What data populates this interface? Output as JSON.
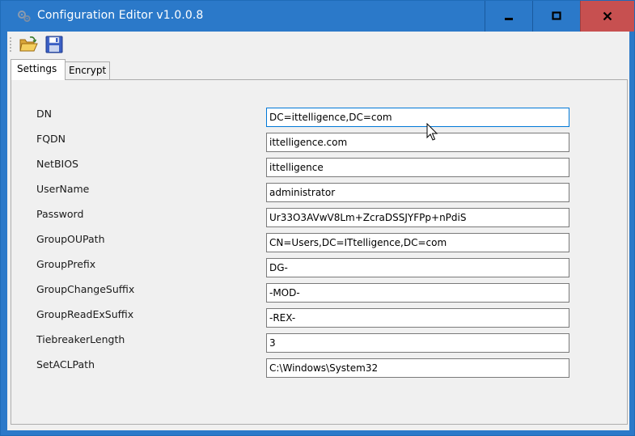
{
  "window": {
    "title": "Configuration Editor v1.0.0.8",
    "controls": {
      "minimize": "minimize",
      "maximize": "maximize",
      "close": "close"
    }
  },
  "toolbar": {
    "open_icon": "open-folder-icon",
    "save_icon": "floppy-disk-icon"
  },
  "tabs": [
    {
      "label": "Settings",
      "active": true
    },
    {
      "label": "Encrypt",
      "active": false
    }
  ],
  "settings": [
    {
      "label": "DN",
      "value": "DC=ittelligence,DC=com"
    },
    {
      "label": "FQDN",
      "value": "ittelligence.com"
    },
    {
      "label": "NetBIOS",
      "value": "ittelligence"
    },
    {
      "label": "UserName",
      "value": "administrator"
    },
    {
      "label": "Password",
      "value": "Ur33O3AVwV8Lm+ZcraDSSJYFPp+nPdiS"
    },
    {
      "label": "GroupOUPath",
      "value": "CN=Users,DC=ITtelligence,DC=com"
    },
    {
      "label": "GroupPrefix",
      "value": "DG-"
    },
    {
      "label": "GroupChangeSuffix",
      "value": "-MOD-"
    },
    {
      "label": "GroupReadExSuffix",
      "value": "-REX-"
    },
    {
      "label": "TiebreakerLength",
      "value": "3"
    },
    {
      "label": "SetACLPath",
      "value": "C:\\Windows\\System32"
    }
  ],
  "colors": {
    "titlebar": "#2b79c9",
    "close_button": "#c75050",
    "client_bg": "#f0f0f0"
  }
}
